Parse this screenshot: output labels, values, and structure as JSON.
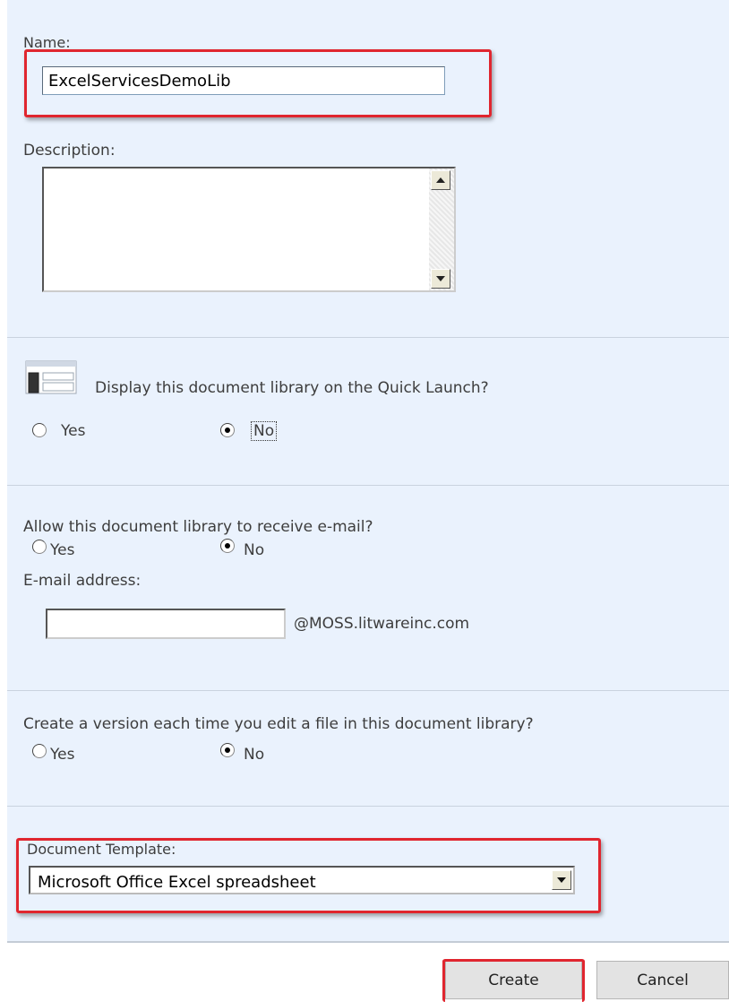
{
  "name_section": {
    "label": "Name:",
    "value": "ExcelServicesDemoLib",
    "description_label": "Description:",
    "description_value": ""
  },
  "quick_launch": {
    "question": "Display this document library on the Quick Launch?",
    "yes_label": "Yes",
    "no_label": "No",
    "selected": "No"
  },
  "email": {
    "question": "Allow this document library to receive e-mail?",
    "yes_label": "Yes",
    "no_label": "No",
    "selected": "No",
    "address_label": "E-mail address:",
    "address_value": "",
    "domain_suffix": "@MOSS.litwareinc.com"
  },
  "versioning": {
    "question": "Create a version each time you edit a file in this document library?",
    "yes_label": "Yes",
    "no_label": "No",
    "selected": "No"
  },
  "template": {
    "label": "Document Template:",
    "selected": "Microsoft Office Excel spreadsheet"
  },
  "buttons": {
    "create": "Create",
    "cancel": "Cancel"
  },
  "colors": {
    "panel_background": "#eaf2fd",
    "highlight": "#e0262f"
  }
}
